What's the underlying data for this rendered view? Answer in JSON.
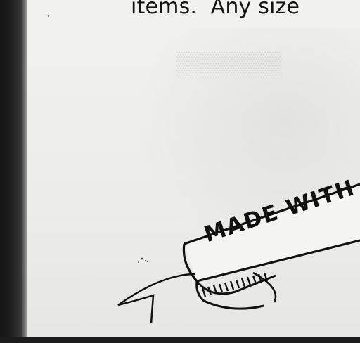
{
  "document": {
    "body_text": "items.  Any size",
    "banner_text": "MADE WITH"
  },
  "colors": {
    "ink": "#141414",
    "paper": "#ececea",
    "scan_edge": "#1b1b1b"
  }
}
